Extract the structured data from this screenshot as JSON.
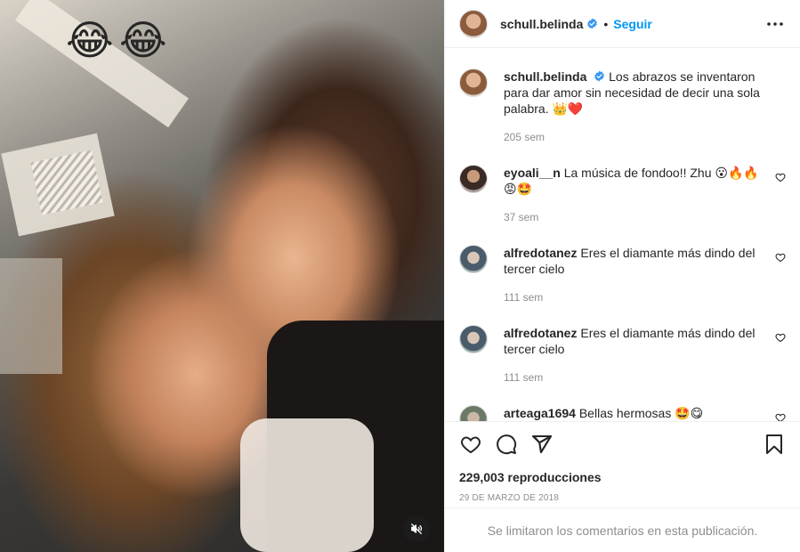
{
  "media": {
    "emoji_overlay": [
      "😂",
      "😂"
    ]
  },
  "header": {
    "username": "schull.belinda",
    "separator": "•",
    "follow_label": "Seguir"
  },
  "caption": {
    "username": "schull.belinda",
    "text": "Los abrazos se inventaron para dar amor sin necesidad de decir una sola palabra. 👑❤️",
    "time": "205 sem"
  },
  "comments": [
    {
      "username": "eyoali__n",
      "text": "La música de fondoo!! Zhu 😮🔥🔥😡🤩",
      "time": "37 sem"
    },
    {
      "username": "alfredotanez",
      "text": "Eres el diamante más dindo del tercer cielo",
      "time": "111 sem"
    },
    {
      "username": "alfredotanez",
      "text": "Eres el diamante más dindo del tercer cielo",
      "time": "111 sem"
    },
    {
      "username": "arteaga1694",
      "text": "Bellas hermosas 🤩😋",
      "time": ""
    }
  ],
  "stats": {
    "views": "229,003 reproducciones",
    "date": "29 de marzo de 2018"
  },
  "footer": {
    "limited_text": "Se limitaron los comentarios en esta publicación."
  },
  "colors": {
    "accent": "#0095f6",
    "verified": "#3897f0",
    "muted_text": "#8e8e8e",
    "border": "#efefef"
  },
  "icons": [
    "mute-icon",
    "verified-icon",
    "more-icon",
    "heart-icon",
    "comment-icon",
    "share-icon",
    "save-icon"
  ]
}
